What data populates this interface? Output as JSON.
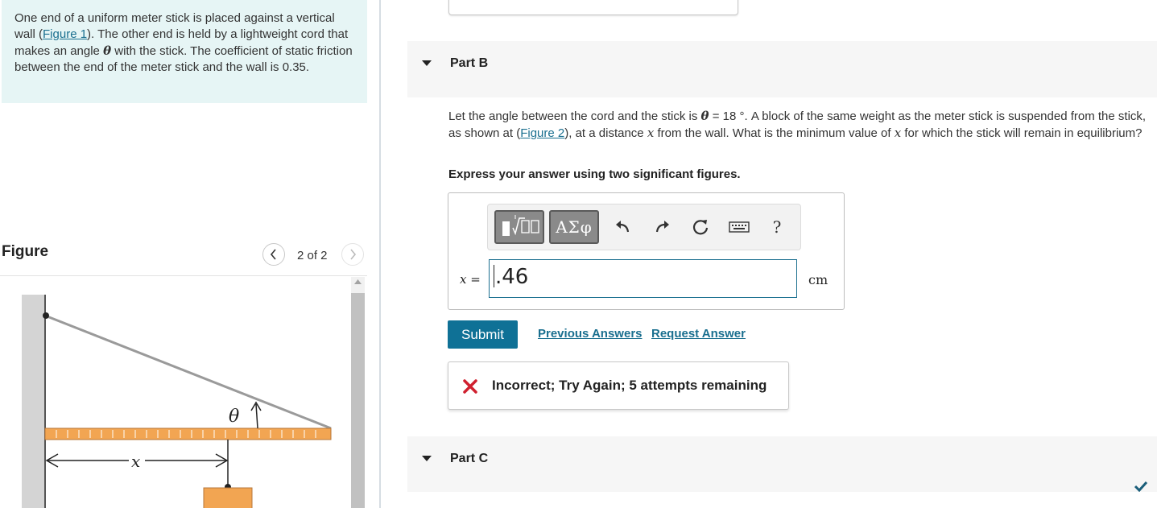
{
  "problem": {
    "text_before": "One end of a uniform meter stick is placed against a vertical wall (",
    "figure_link": "Figure 1",
    "text_mid": "). The other end is held by a lightweight cord that makes an angle ",
    "symbol": "θ",
    "text_after": " with the stick. The coefficient of static friction between the end of the meter stick and the wall is 0.35."
  },
  "figure_panel": {
    "title": "Figure",
    "page_indicator": "2 of 2",
    "labels": {
      "theta": "θ",
      "x": "x"
    }
  },
  "part_b": {
    "label": "Part B",
    "question": {
      "t1": "Let the angle between the cord and the stick is ",
      "sym": "θ",
      "t2": " = 18 °. A block of the same weight as the meter stick is suspended from the stick, as shown at (",
      "figure_link": "Figure 2",
      "t3": "), at a distance ",
      "var1": "x",
      "t4": " from the wall. What is the minimum value of ",
      "var2": "x",
      "t5": " for which the stick will remain in equilibrium?"
    },
    "instruction": "Express your answer using two significant figures.",
    "toolbar": {
      "greek_label": "ΑΣφ",
      "help_label": "?"
    },
    "input": {
      "var_label": "x",
      "equals": " =",
      "value": ".46",
      "unit": "cm"
    },
    "submit_label": "Submit",
    "previous_answers_label": "Previous Answers",
    "request_answer_label": "Request Answer",
    "feedback": "Incorrect; Try Again; 5 attempts remaining"
  },
  "part_c": {
    "label": "Part C"
  },
  "colors": {
    "accent": "#0f7196",
    "error": "#d0202f",
    "success": "#1a5e7a",
    "problem_bg": "#e6f5f5",
    "block": "#f2a552"
  }
}
